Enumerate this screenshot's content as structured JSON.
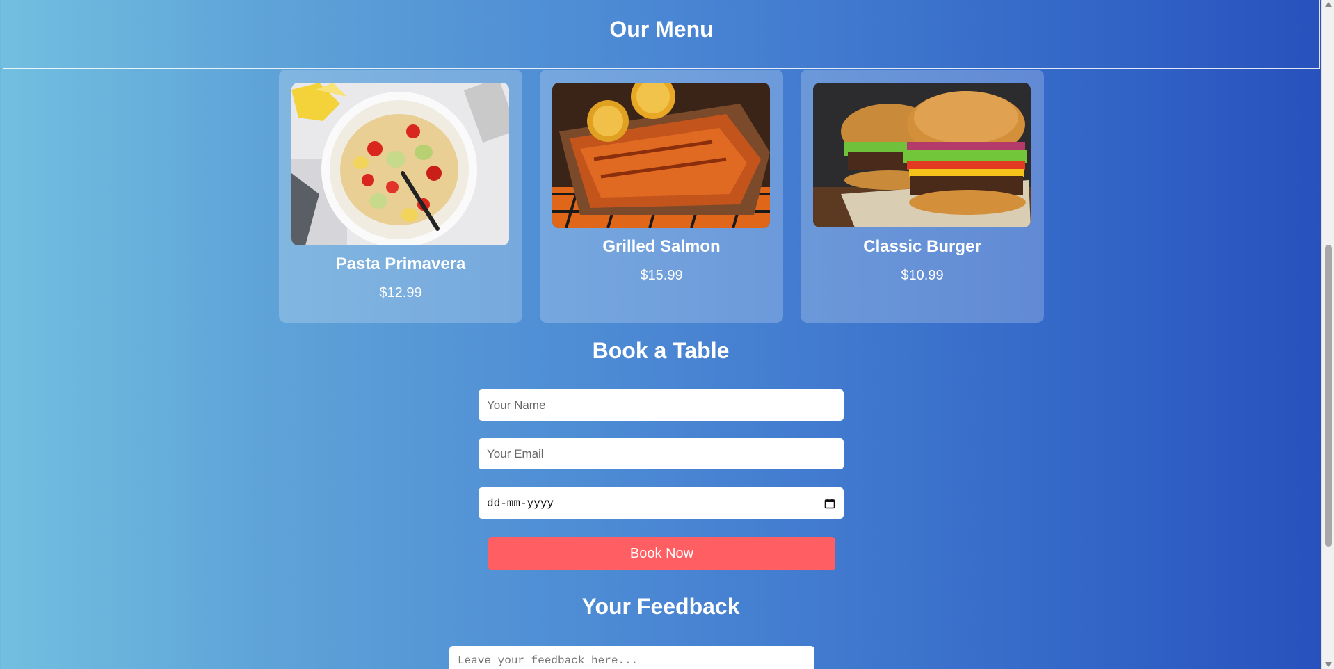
{
  "header": {
    "title": "Our Menu"
  },
  "menu": {
    "items": [
      {
        "name": "Pasta Primavera",
        "price": "$12.99"
      },
      {
        "name": "Grilled Salmon",
        "price": "$15.99"
      },
      {
        "name": "Classic Burger",
        "price": "$10.99"
      }
    ]
  },
  "booking": {
    "title": "Book a Table",
    "name_placeholder": "Your Name",
    "email_placeholder": "Your Email",
    "date_placeholder": "dd-mm-yyyy",
    "submit_label": "Book Now"
  },
  "feedback": {
    "title": "Your Feedback",
    "placeholder": "Leave your feedback here..."
  },
  "colors": {
    "accent": "#ff5e62",
    "gradient_start": "#72bfe0",
    "gradient_end": "#2750bc"
  }
}
